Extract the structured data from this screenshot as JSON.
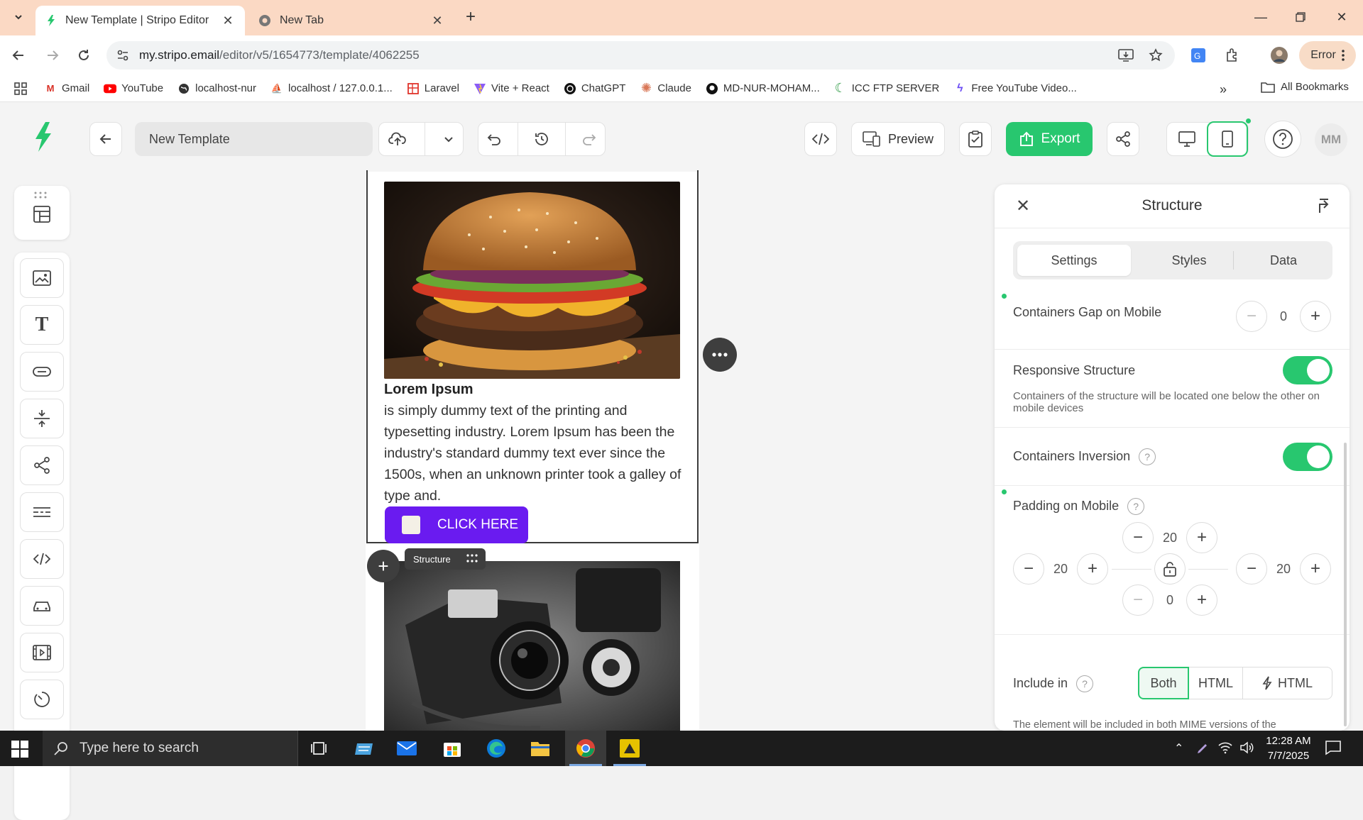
{
  "browser": {
    "tabs": [
      {
        "title": "New Template | Stripo Editor",
        "active": true
      },
      {
        "title": "New Tab",
        "active": false
      }
    ],
    "url_host": "my.stripo.email",
    "url_path": "/editor/v5/1654773/template/4062255",
    "profile_status": "Error",
    "bookmarks": [
      {
        "label": "Gmail",
        "icon": "gmail-icon"
      },
      {
        "label": "YouTube",
        "icon": "youtube-icon"
      },
      {
        "label": "localhost-nur",
        "icon": "globe-icon"
      },
      {
        "label": "localhost / 127.0.0.1...",
        "icon": "phpmyadmin-icon"
      },
      {
        "label": "Laravel",
        "icon": "laravel-icon"
      },
      {
        "label": "Vite + React",
        "icon": "vite-icon"
      },
      {
        "label": "ChatGPT",
        "icon": "chatgpt-icon"
      },
      {
        "label": "Claude",
        "icon": "claude-icon"
      },
      {
        "label": "MD-NUR-MOHAM...",
        "icon": "github-icon"
      },
      {
        "label": "ICC FTP SERVER",
        "icon": "icc-icon"
      },
      {
        "label": "Free YouTube Video...",
        "icon": "bolt-icon"
      }
    ],
    "all_bookmarks": "All Bookmarks"
  },
  "editor": {
    "template_name": "New Template",
    "preview_label": "Preview",
    "export_label": "Export",
    "user_initials": "MM",
    "accent": "#28c76f"
  },
  "canvas": {
    "heading": "Lorem Ipsum",
    "body": " is simply dummy text of the printing and typesetting industry. Lorem Ipsum has been the industry's standard dummy text ever since the 1500s, when an unknown printer took a galley of type and.",
    "cta_label": "CLICK HERE",
    "cta_color": "#6a1bf0",
    "structure_tag": "Structure"
  },
  "panel": {
    "title": "Structure",
    "tabs": [
      "Settings",
      "Styles",
      "Data"
    ],
    "containers_gap_label": "Containers Gap on Mobile",
    "containers_gap_value": "0",
    "responsive_label": "Responsive Structure",
    "responsive_desc": "Containers of the structure will be located one below the other on mobile devices",
    "responsive_on": true,
    "inversion_label": "Containers Inversion",
    "inversion_on": true,
    "padding_label": "Padding on Mobile",
    "padding_top": "20",
    "padding_left": "20",
    "padding_right": "20",
    "padding_bottom": "0",
    "include_label": "Include in",
    "include_options": [
      "Both",
      "HTML",
      "HTML"
    ],
    "include_desc": "The element will be included in both MIME versions of the"
  },
  "taskbar": {
    "search_placeholder": "Type here to search",
    "time": "12:28 AM",
    "date": "7/7/2025"
  }
}
